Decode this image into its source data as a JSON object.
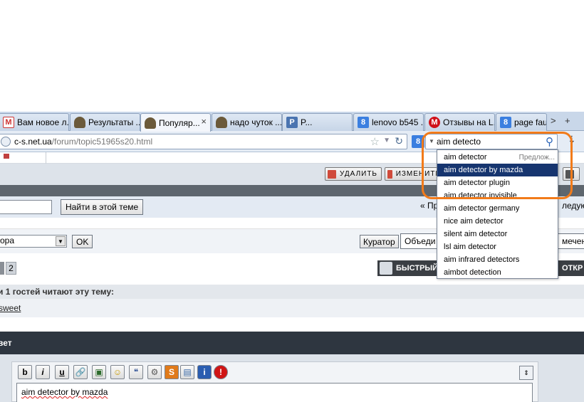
{
  "browser": {
    "tabs": [
      {
        "icon": "gmail-icon",
        "label": "Вам новое л...",
        "active": false
      },
      {
        "icon": "person-icon",
        "label": "Результаты ...",
        "active": false
      },
      {
        "icon": "person-icon",
        "label": "Популяр...",
        "active": true
      },
      {
        "icon": "person-icon",
        "label": "надо чуток ...",
        "active": false
      },
      {
        "icon": "p-icon",
        "label": "P...",
        "active": false
      },
      {
        "icon": "google-icon",
        "label": "lenovo b545 ...",
        "active": false
      },
      {
        "icon": "red-m-icon",
        "label": "Отзывы на L...",
        "active": false
      },
      {
        "icon": "google-icon",
        "label": "page fault",
        "active": false
      }
    ],
    "tab_close_glyph": "×",
    "tab_scroll_glyph": ">",
    "new_tab_glyph": "+",
    "url_host": "c-s.net.ua",
    "url_path": "/forum/topic51965s20.html",
    "search_query": "aim detecto",
    "search_engine_letter": "8"
  },
  "suggestions": {
    "hint": "Предлож...",
    "selected_index": 1,
    "items": [
      "aim detector",
      "aim detector by mazda",
      "aim detector plugin",
      "aim detector invisible",
      "aim detector germany",
      "nice aim detector",
      "silent aim detector",
      "lsl aim detector",
      "aim infrared detectors",
      "aimbot detection"
    ]
  },
  "forum": {
    "moderation_buttons": [
      "УДАЛИТЬ",
      "ИЗМЕНИТЬ"
    ],
    "find_in_topic": "Найти в этой теме",
    "prev_label": "« Пр",
    "next_label": "ледующ",
    "mod_select_value": "ора",
    "ok_label": "OK",
    "curator_label": "Куратор",
    "merge_label": "Объеди",
    "marked_label": "мечен",
    "pages": [
      "2"
    ],
    "quick_reply": "БЫСТРЫЙ",
    "open_label": "ОТКР",
    "readers_text": "и 1 гостей читают эту тему:",
    "reader_user": "sweet",
    "reply_title": "вет",
    "editor_buttons": [
      {
        "icon": "bold-icon",
        "glyph": "b"
      },
      {
        "icon": "italic-icon",
        "glyph": "i"
      },
      {
        "icon": "underline-icon",
        "glyph": "u"
      },
      {
        "icon": "link-icon",
        "glyph": "🔗"
      },
      {
        "icon": "image-icon",
        "glyph": "▣"
      },
      {
        "icon": "smiley-icon",
        "glyph": "☺"
      },
      {
        "icon": "quote-icon",
        "glyph": "❝"
      },
      {
        "icon": "code-icon",
        "glyph": "⚙"
      },
      {
        "icon": "strike-icon",
        "glyph": "S"
      },
      {
        "icon": "file-icon",
        "glyph": "▤"
      },
      {
        "icon": "info-icon",
        "glyph": "i"
      },
      {
        "icon": "stop-icon",
        "glyph": "!"
      }
    ],
    "editor_text": "aim detector by mazda"
  },
  "colors": {
    "highlight": "#f27b1a",
    "selected_suggestion": "#16356f",
    "dark_header": "#2e3640"
  }
}
